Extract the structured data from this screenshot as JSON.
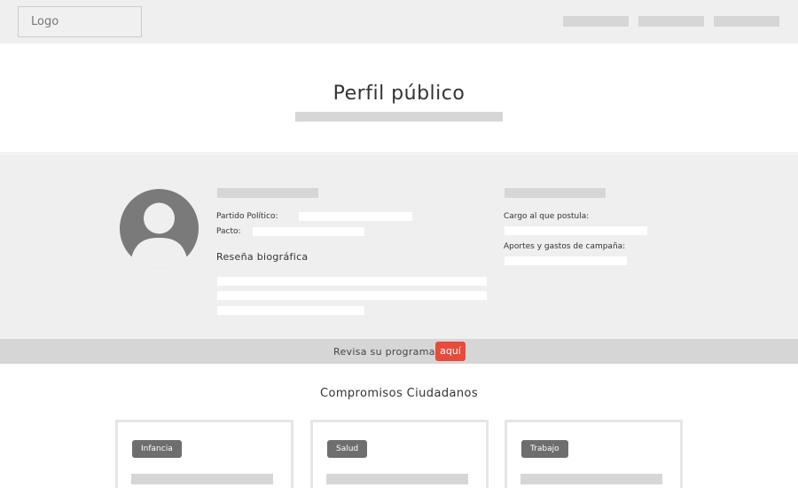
{
  "header": {
    "logo_label": "Logo",
    "nav": [
      "",
      "",
      ""
    ]
  },
  "title": {
    "text": "Perfil público"
  },
  "profile": {
    "party_label": "Partido Político:",
    "pact_label": "Pacto:",
    "bio_heading": "Reseña biográfica",
    "position_label": "Cargo al que postula:",
    "funding_label": "Aportes y gastos de campaña:"
  },
  "program": {
    "text": "Revisa su programa",
    "link_label": "aquí",
    "link_color": "#e84a3c"
  },
  "commitments": {
    "heading": "Compromisos Ciudadanos",
    "cards": [
      {
        "tag": "Infancia"
      },
      {
        "tag": "Salud"
      },
      {
        "tag": "Trabajo"
      }
    ]
  }
}
